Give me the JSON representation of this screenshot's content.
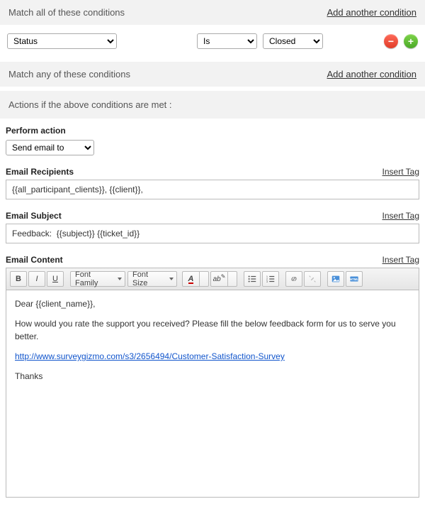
{
  "match_all": {
    "title": "Match all of these conditions",
    "add_link": "Add another condition",
    "row": {
      "field": "Status",
      "operator": "Is",
      "value": "Closed"
    }
  },
  "match_any": {
    "title": "Match any of these conditions",
    "add_link": "Add another condition"
  },
  "actions_header": "Actions if the above conditions are met :",
  "perform": {
    "label": "Perform action",
    "value": "Send email to"
  },
  "recipients": {
    "label": "Email Recipients",
    "insert": "Insert Tag",
    "value": "{{all_participant_clients}}, {{client}},"
  },
  "subject": {
    "label": "Email Subject",
    "insert": "Insert Tag",
    "value": "Feedback:  {{subject}} {{ticket_id}}"
  },
  "content": {
    "label": "Email Content",
    "insert": "Insert Tag",
    "toolbar": {
      "font_family": "Font Family",
      "font_size": "Font Size"
    },
    "body": {
      "greeting": "Dear  {{client_name}},",
      "line1": "How would you rate the support you received? Please fill the below feedback form for us to serve you better.",
      "link": "http://www.surveygizmo.com/s3/2656494/Customer-Satisfaction-Survey",
      "thanks": "Thanks"
    }
  }
}
